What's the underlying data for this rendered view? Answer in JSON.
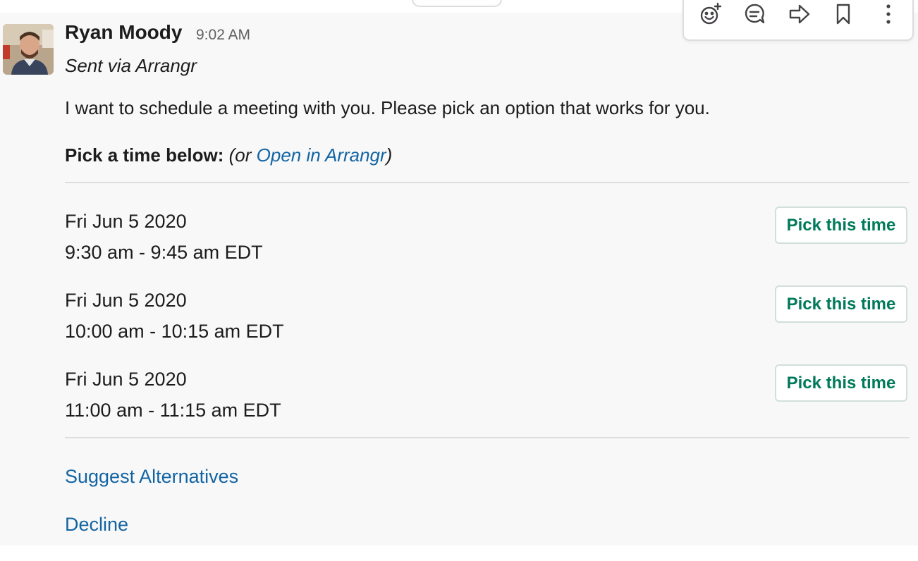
{
  "message": {
    "sender_name": "Ryan Moody",
    "timestamp": "9:02 AM",
    "sent_via": "Sent via Arrangr",
    "body": "I want to schedule a meeting with you. Please pick an option that works for you.",
    "pick_prompt_bold": "Pick a time below:",
    "pick_prompt_open": "(or ",
    "pick_prompt_link": "Open in Arrangr",
    "pick_prompt_close": ")"
  },
  "options": [
    {
      "date": "Fri Jun 5 2020",
      "range": "9:30 am - 9:45 am EDT",
      "button": "Pick this time"
    },
    {
      "date": "Fri Jun 5 2020",
      "range": "10:00 am - 10:15 am EDT",
      "button": "Pick this time"
    },
    {
      "date": "Fri Jun 5 2020",
      "range": "11:00 am - 11:15 am EDT",
      "button": "Pick this time"
    }
  ],
  "actions": {
    "suggest": "Suggest Alternatives",
    "decline": "Decline"
  },
  "toolbar": {
    "icons": [
      "add-reaction-icon",
      "reply-thread-icon",
      "share-icon",
      "bookmark-icon",
      "more-actions-icon"
    ]
  },
  "colors": {
    "link": "#1264a3",
    "button_text": "#007a5a",
    "background": "#f8f8f8"
  }
}
